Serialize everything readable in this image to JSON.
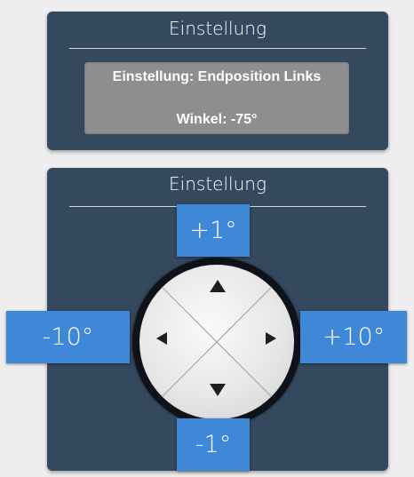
{
  "status_panel": {
    "title": "Einstellung",
    "line1": "Einstellung: Endposition Links",
    "line2": "Winkel: -75°"
  },
  "control_panel": {
    "title": "Einstellung",
    "buttons": {
      "plus1": "+1°",
      "minus1": "-1°",
      "minus10": "-10°",
      "plus10": "+10°"
    },
    "dpad": {
      "up_icon": "triangle-up",
      "down_icon": "triangle-down",
      "left_icon": "triangle-left",
      "right_icon": "triangle-right"
    }
  },
  "colors": {
    "panel_bg": "#34495e",
    "button_bg": "#3f88d8",
    "display_bg": "#8e8e8e",
    "page_bg": "#eeeeee"
  }
}
